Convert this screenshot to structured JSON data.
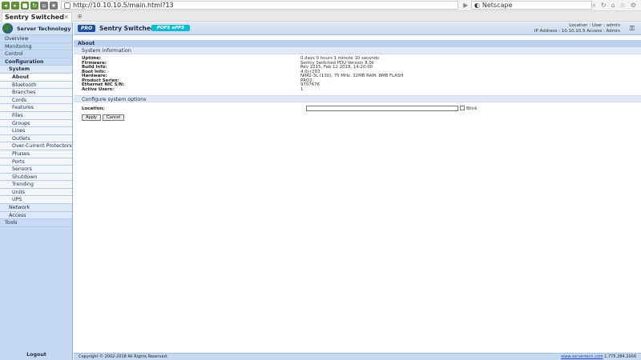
{
  "browser": {
    "url": "http://10.10.10.5/main.html?13",
    "search_placeholder": "Netscape",
    "tab_title": "Sentry Switched PDU",
    "tab_close": "✕",
    "new_tab": "⊕"
  },
  "sidebar": {
    "brand": "Server Technology",
    "items": [
      {
        "label": "Overview",
        "level": 1,
        "bold": false
      },
      {
        "label": "Monitoring",
        "level": 1,
        "bold": false
      },
      {
        "label": "Control",
        "level": 1,
        "bold": false
      },
      {
        "label": "Configuration",
        "level": 1,
        "bold": true
      },
      {
        "label": "System",
        "level": 2,
        "bold": true
      },
      {
        "label": "About",
        "level": 3,
        "active": true
      },
      {
        "label": "Bluetooth",
        "level": 3
      },
      {
        "label": "Branches",
        "level": 3
      },
      {
        "label": "Cords",
        "level": 3
      },
      {
        "label": "Features",
        "level": 3
      },
      {
        "label": "Files",
        "level": 3
      },
      {
        "label": "Groups",
        "level": 3
      },
      {
        "label": "Lines",
        "level": 3
      },
      {
        "label": "Outlets",
        "level": 3
      },
      {
        "label": "Over-Current Protectors",
        "level": 3
      },
      {
        "label": "Phases",
        "level": 3
      },
      {
        "label": "Ports",
        "level": 3
      },
      {
        "label": "Sensors",
        "level": 3
      },
      {
        "label": "Shutdown",
        "level": 3
      },
      {
        "label": "Trending",
        "level": 3
      },
      {
        "label": "Units",
        "level": 3
      },
      {
        "label": "UPS",
        "level": 3
      },
      {
        "label": "Network",
        "level": 2
      },
      {
        "label": "Access",
        "level": 2
      },
      {
        "label": "Tools",
        "level": 1
      }
    ],
    "logout": "Logout"
  },
  "header": {
    "pro_badge": "PRO",
    "product_name": "Sentry Switched PDU",
    "pops_badge": "POPS ePPS",
    "location_line": "Location :   User : admin",
    "ip_line": "IP Address : 10.10.10.5   Access : Admin"
  },
  "page": {
    "title": "About",
    "section": "System information",
    "info": [
      {
        "key": "Uptime:",
        "value": "0 days 0 hours 1 minute 10 seconds"
      },
      {
        "key": "Firmware:",
        "value": "Sentry Switched PDU Version 8.0k"
      },
      {
        "key": "Build Info:",
        "value": "Rev 2215, Feb 12 2018, 14:20:00"
      },
      {
        "key": "Boot Info:",
        "value": "4.0j-r203"
      },
      {
        "key": "Hardware:",
        "value": "NIM2-3L (130), 75 MHz, 32MB RAM, 8MB FLASH"
      },
      {
        "key": "Product Series:",
        "value": "PRO2"
      },
      {
        "key": "Ethernet NIC S/N:",
        "value": "9707676"
      },
      {
        "key": "Active Users:",
        "value": "1"
      }
    ],
    "options_section": "Configure system options",
    "location_label": "Location:",
    "location_value": "",
    "blink_label": "Blink",
    "apply": "Apply",
    "cancel": "Cancel"
  },
  "footer": {
    "copyright": "Copyright © 2002-2018 All Rights Reserved.",
    "link": "www.servertech.com",
    "phone": "1.775.284.2000"
  }
}
